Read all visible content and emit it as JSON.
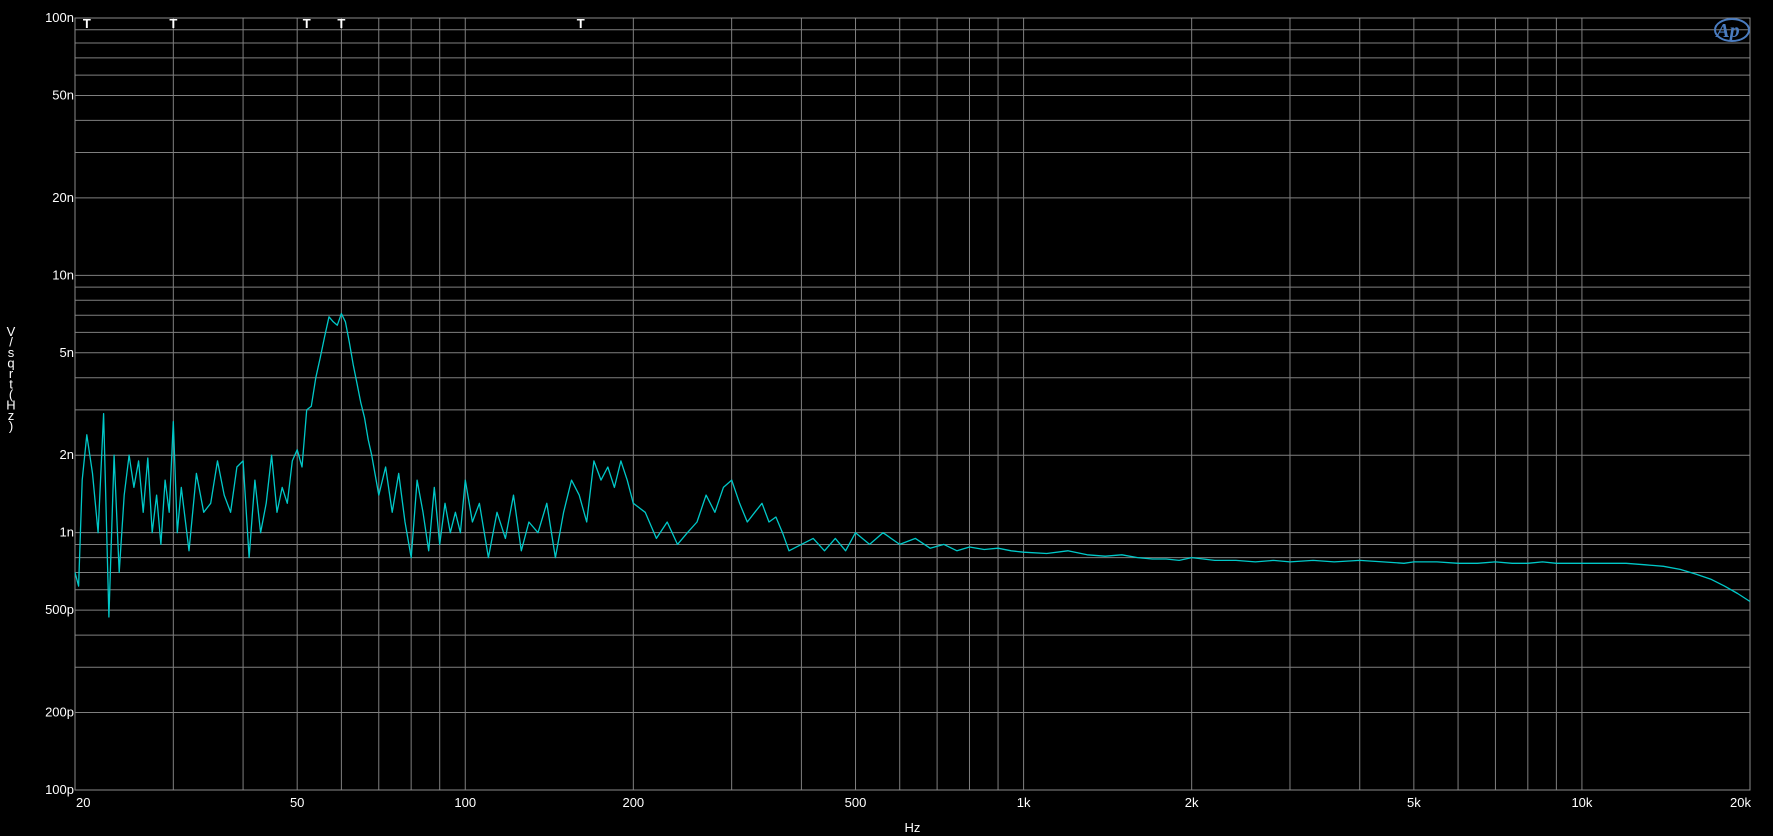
{
  "chart_data": {
    "type": "line",
    "title": "",
    "xlabel": "Hz",
    "ylabel": "V/sqrt(Hz)",
    "x_scale": "log",
    "y_scale": "log",
    "xlim": [
      20,
      20000
    ],
    "ylim": [
      1e-10,
      1e-07
    ],
    "grid": true,
    "x_ticks": [
      {
        "value": 20,
        "label": "20"
      },
      {
        "value": 50,
        "label": "50"
      },
      {
        "value": 100,
        "label": "100"
      },
      {
        "value": 200,
        "label": "200"
      },
      {
        "value": 500,
        "label": "500"
      },
      {
        "value": 1000,
        "label": "1k"
      },
      {
        "value": 2000,
        "label": "2k"
      },
      {
        "value": 5000,
        "label": "5k"
      },
      {
        "value": 10000,
        "label": "10k"
      },
      {
        "value": 20000,
        "label": "20k"
      }
    ],
    "y_ticks": [
      {
        "value": 1e-07,
        "label": "100n"
      },
      {
        "value": 5e-08,
        "label": "50n"
      },
      {
        "value": 2e-08,
        "label": "20n"
      },
      {
        "value": 1e-08,
        "label": "10n"
      },
      {
        "value": 5e-09,
        "label": "5n"
      },
      {
        "value": 2e-09,
        "label": "2n"
      },
      {
        "value": 1e-09,
        "label": "1n"
      },
      {
        "value": 5e-10,
        "label": "500p"
      },
      {
        "value": 2e-10,
        "label": "200p"
      },
      {
        "value": 1e-10,
        "label": "100p"
      }
    ],
    "markers": [
      {
        "x": 21,
        "label": "T"
      },
      {
        "x": 30,
        "label": "T"
      },
      {
        "x": 52,
        "label": "T"
      },
      {
        "x": 60,
        "label": "T"
      },
      {
        "x": 161,
        "label": "T"
      }
    ],
    "logo": "Ap",
    "colors": {
      "background": "#000000",
      "grid": "#7f7f7f",
      "trace": "#00c8c8",
      "text": "#ffffff",
      "logo": "#4a7cc0"
    },
    "series": [
      {
        "x": [
          20,
          20.3,
          20.6,
          21,
          21.5,
          22,
          22.5,
          23,
          23.5,
          24,
          24.5,
          25,
          25.5,
          26,
          26.5,
          27,
          27.5,
          28,
          28.5,
          29,
          29.5,
          30,
          30.5,
          31,
          32,
          33,
          34,
          35,
          36,
          37,
          38,
          39,
          40,
          41,
          42,
          43,
          44,
          45,
          46,
          47,
          48,
          49,
          50,
          51,
          52,
          53,
          54,
          55,
          56,
          57,
          58,
          59,
          60,
          61,
          62,
          63,
          64,
          65,
          66,
          67,
          68,
          70,
          72,
          74,
          76,
          78,
          80,
          82,
          84,
          86,
          88,
          90,
          92,
          94,
          96,
          98,
          100,
          103,
          106,
          110,
          114,
          118,
          122,
          126,
          130,
          135,
          140,
          145,
          150,
          155,
          160,
          165,
          170,
          175,
          180,
          185,
          190,
          195,
          200,
          210,
          220,
          230,
          240,
          250,
          260,
          270,
          280,
          290,
          300,
          310,
          320,
          330,
          340,
          350,
          360,
          370,
          380,
          400,
          420,
          440,
          460,
          480,
          500,
          530,
          560,
          600,
          640,
          680,
          720,
          760,
          800,
          850,
          900,
          950,
          1000,
          1100,
          1200,
          1300,
          1400,
          1500,
          1600,
          1700,
          1800,
          1900,
          2000,
          2200,
          2400,
          2600,
          2800,
          3000,
          3300,
          3600,
          4000,
          4400,
          4800,
          5000,
          5500,
          6000,
          6500,
          7000,
          7500,
          8000,
          8500,
          9000,
          10000,
          11000,
          12000,
          13000,
          14000,
          15000,
          16000,
          17000,
          18000,
          19000,
          20000
        ],
        "y": [
          7e-10,
          6.2e-10,
          1.6e-09,
          2.4e-09,
          1.7e-09,
          1e-09,
          2.9e-09,
          4.7e-10,
          2e-09,
          7e-10,
          1.4e-09,
          2e-09,
          1.5e-09,
          1.9e-09,
          1.2e-09,
          1.95e-09,
          1e-09,
          1.4e-09,
          9e-10,
          1.6e-09,
          1.2e-09,
          2.7e-09,
          1e-09,
          1.5e-09,
          8.5e-10,
          1.7e-09,
          1.2e-09,
          1.3e-09,
          1.9e-09,
          1.4e-09,
          1.2e-09,
          1.8e-09,
          1.9e-09,
          8e-10,
          1.6e-09,
          1e-09,
          1.3e-09,
          2e-09,
          1.2e-09,
          1.5e-09,
          1.3e-09,
          1.9e-09,
          2.1e-09,
          1.8e-09,
          3e-09,
          3.1e-09,
          4e-09,
          4.8e-09,
          5.8e-09,
          6.9e-09,
          6.6e-09,
          6.4e-09,
          7.1e-09,
          6.6e-09,
          5.5e-09,
          4.5e-09,
          3.8e-09,
          3.2e-09,
          2.8e-09,
          2.3e-09,
          2e-09,
          1.4e-09,
          1.8e-09,
          1.2e-09,
          1.7e-09,
          1.1e-09,
          8e-10,
          1.6e-09,
          1.2e-09,
          8.5e-10,
          1.5e-09,
          9e-10,
          1.3e-09,
          1e-09,
          1.2e-09,
          1e-09,
          1.6e-09,
          1.1e-09,
          1.3e-09,
          8e-10,
          1.2e-09,
          9.5e-10,
          1.4e-09,
          8.5e-10,
          1.1e-09,
          1e-09,
          1.3e-09,
          8e-10,
          1.2e-09,
          1.6e-09,
          1.4e-09,
          1.1e-09,
          1.9e-09,
          1.6e-09,
          1.8e-09,
          1.5e-09,
          1.9e-09,
          1.6e-09,
          1.3e-09,
          1.2e-09,
          9.5e-10,
          1.1e-09,
          9e-10,
          1e-09,
          1.1e-09,
          1.4e-09,
          1.2e-09,
          1.5e-09,
          1.6e-09,
          1.3e-09,
          1.1e-09,
          1.2e-09,
          1.3e-09,
          1.1e-09,
          1.15e-09,
          1e-09,
          8.5e-10,
          9e-10,
          9.5e-10,
          8.5e-10,
          9.5e-10,
          8.5e-10,
          1e-09,
          9e-10,
          1e-09,
          9e-10,
          9.5e-10,
          8.7e-10,
          9e-10,
          8.5e-10,
          8.8e-10,
          8.6e-10,
          8.7e-10,
          8.5e-10,
          8.4e-10,
          8.3e-10,
          8.5e-10,
          8.2e-10,
          8.1e-10,
          8.2e-10,
          8e-10,
          7.9e-10,
          7.9e-10,
          7.8e-10,
          8e-10,
          7.8e-10,
          7.8e-10,
          7.7e-10,
          7.8e-10,
          7.7e-10,
          7.8e-10,
          7.7e-10,
          7.8e-10,
          7.7e-10,
          7.6e-10,
          7.7e-10,
          7.7e-10,
          7.6e-10,
          7.6e-10,
          7.7e-10,
          7.6e-10,
          7.6e-10,
          7.7e-10,
          7.6e-10,
          7.6e-10,
          7.6e-10,
          7.6e-10,
          7.5e-10,
          7.4e-10,
          7.2e-10,
          6.9e-10,
          6.6e-10,
          6.2e-10,
          5.8e-10,
          5.4e-10
        ]
      }
    ]
  }
}
